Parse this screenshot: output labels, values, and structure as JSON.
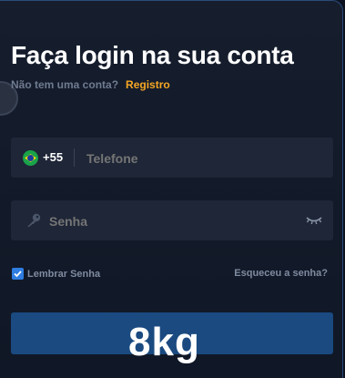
{
  "login": {
    "title": "Faça login na sua conta",
    "no_account_text": "Não tem uma conta?",
    "register_link": "Registro",
    "phone": {
      "country_icon": "brazil-flag-icon",
      "dial_code": "+55",
      "placeholder": "Telefone"
    },
    "password": {
      "icon": "key-icon",
      "placeholder": "Senha",
      "toggle_icon": "eye-closed-icon"
    },
    "remember_label": "Lembrar Senha",
    "remember_checked": true,
    "forgot_link": "Esqueceu a senha?",
    "watermark": "8kg"
  },
  "colors": {
    "accent_orange": "#f5a623",
    "checkbox_blue": "#2f7de1",
    "button_blue": "#1a4a80",
    "field_bg": "#1e2637"
  }
}
